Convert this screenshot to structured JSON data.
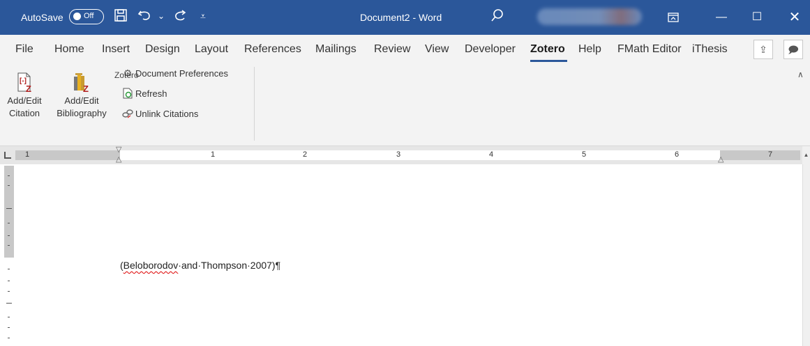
{
  "titlebar": {
    "autosave_label": "AutoSave",
    "autosave_state": "Off",
    "document_title": "Document2  -  Word",
    "icons": [
      "save-icon",
      "undo-icon",
      "dropdown-icon",
      "redo-icon",
      "customize-icon",
      "search-icon",
      "ribbon-display-icon",
      "minimize-icon",
      "maximize-icon",
      "close-icon"
    ]
  },
  "tabs": [
    "File",
    "Home",
    "Insert",
    "Design",
    "Layout",
    "References",
    "Mailings",
    "Review",
    "View",
    "Developer",
    "Zotero",
    "Help",
    "FMath Editor",
    "iThesis"
  ],
  "active_tab": "Zotero",
  "ribbon": {
    "add_edit_citation_line1": "Add/Edit",
    "add_edit_citation_line2": "Citation",
    "add_edit_bibliography_line1": "Add/Edit",
    "add_edit_bibliography_line2": "Bibliography",
    "document_preferences": "Document Preferences",
    "refresh": "Refresh",
    "unlink_citations": "Unlink Citations",
    "group_label": "Zotero"
  },
  "ruler": {
    "numbers": [
      "1",
      "1",
      "2",
      "3",
      "4",
      "5",
      "6",
      "7"
    ]
  },
  "document": {
    "citation_open": "(",
    "citation_author": "Beloborodov",
    "citation_rest": "·and·Thompson·2007)¶"
  },
  "colors": {
    "title_bar": "#2b579a",
    "ribbon_bg": "#f3f3f3",
    "zotero_red": "#b01e1e"
  }
}
